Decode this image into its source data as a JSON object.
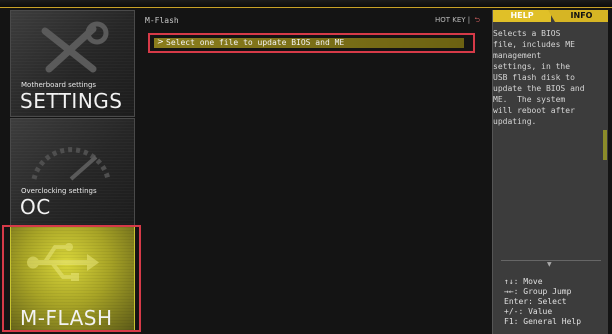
{
  "sidebar": {
    "settings": {
      "subtitle": "Motherboard settings",
      "title": "SETTINGS"
    },
    "oc": {
      "subtitle": "Overclocking settings",
      "title": "OC"
    },
    "mflash": {
      "title": "M-FLASH"
    }
  },
  "main": {
    "breadcrumb": "M-Flash",
    "hotkey": "HOT KEY",
    "hotkey_sep": "|",
    "back_icon": "back-arrow-icon",
    "selected_arrow": ">",
    "selected_item": "Select one file to update BIOS and ME"
  },
  "right_panel": {
    "tab_help": "HELP",
    "tab_info": "INFO",
    "help_text": "Selects a BIOS\nfile, includes ME\nmanagement\nsettings, in the\nUSB flash disk to\nupdate the BIOS and\nME.  The system\nwill reboot after\nupdating.",
    "keys": [
      "↑↓: Move",
      "→←: Group Jump",
      "Enter: Select",
      "+/-: Value",
      "F1: General Help"
    ]
  },
  "colors": {
    "accent_yellow": "#e0c028",
    "highlight_red": "#d63a48",
    "selection_bg": "#8a7d1c"
  }
}
